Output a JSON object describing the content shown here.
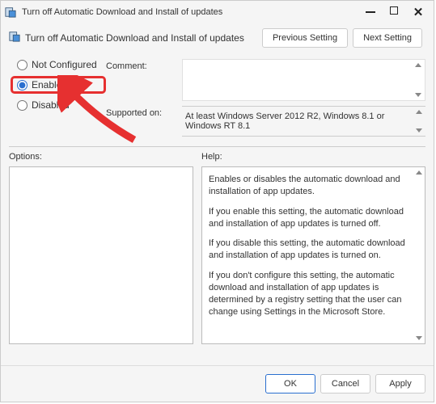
{
  "window": {
    "title": "Turn off Automatic Download and Install of updates"
  },
  "subtitle": "Turn off Automatic Download and Install of updates",
  "nav": {
    "prev": "Previous Setting",
    "next": "Next Setting"
  },
  "radios": {
    "not_configured": "Not Configured",
    "enabled": "Enabled",
    "disabled": "Disabled",
    "selected": "enabled"
  },
  "fields": {
    "comment_label": "Comment:",
    "comment_value": "",
    "supported_label": "Supported on:",
    "supported_value": "At least Windows Server 2012 R2, Windows 8.1 or Windows RT 8.1"
  },
  "panels": {
    "options_label": "Options:",
    "help_label": "Help:"
  },
  "help": {
    "p1": "Enables or disables the automatic download and installation of app updates.",
    "p2": "If you enable this setting, the automatic download and installation of app updates is turned off.",
    "p3": "If you disable this setting, the automatic download and installation of app updates is turned on.",
    "p4": "If you don't configure this setting, the automatic download and installation of app updates is determined by a registry setting that the user can change using Settings in the Microsoft Store."
  },
  "footer": {
    "ok": "OK",
    "cancel": "Cancel",
    "apply": "Apply"
  }
}
